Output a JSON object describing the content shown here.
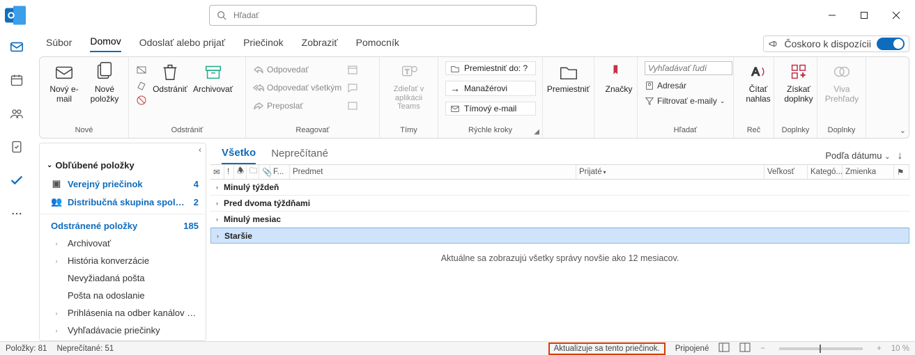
{
  "search_placeholder": "Hľadať",
  "tabs": {
    "file": "Súbor",
    "home": "Domov",
    "sendrec": "Odoslať alebo prijať",
    "folder": "Priečinok",
    "view": "Zobraziť",
    "help": "Pomocník"
  },
  "coming_soon": "Čoskoro k dispozícii",
  "ribbon": {
    "new": {
      "new_email": "Nový e-mail",
      "new_items": "Nové položky",
      "group": "Nové"
    },
    "delete": {
      "delete": "Odstrániť",
      "archive": "Archivovať",
      "group": "Odstrániť"
    },
    "respond": {
      "reply": "Odpovedať",
      "reply_all": "Odpovedať všetkým",
      "forward": "Preposlať",
      "group": "Reagovať"
    },
    "teams": {
      "share": "Zdieľať v aplikácii Teams",
      "group": "Tímy"
    },
    "quick": {
      "move_to": "Premiestniť do: ?",
      "manager": "Manažérovi",
      "team_mail": "Tímový e-mail",
      "group": "Rýchle kroky"
    },
    "move": {
      "move": "Premiestniť",
      "group": ""
    },
    "tags": {
      "tags": "Značky",
      "group": ""
    },
    "find": {
      "placeholder": "Vyhľadávať ľudí",
      "address": "Adresár",
      "filter": "Filtrovať e-maily",
      "group": "Hľadať"
    },
    "speech": {
      "read": "Čítať nahlas",
      "group": "Reč"
    },
    "addins": {
      "get": "Získať doplnky",
      "group": "Doplnky"
    },
    "viva": {
      "viva": "Viva Prehľady",
      "group": "Doplnky"
    }
  },
  "nav": {
    "fav_header": "Obľúbené položky",
    "items": [
      {
        "name": "Verejný priečinok",
        "count": "4",
        "bold": true,
        "icon": "folder"
      },
      {
        "name": "Distribučná skupina spolo...",
        "count": "2",
        "bold": true,
        "icon": "group"
      },
      {
        "name": "Odstránené položky",
        "count": "185",
        "bold": true,
        "icon": ""
      },
      {
        "name": "Archivovať",
        "expander": true
      },
      {
        "name": "História konverzácie",
        "expander": true
      },
      {
        "name": "Nevyžiadaná pošta"
      },
      {
        "name": "Pošta na odoslanie"
      },
      {
        "name": "Prihlásenia na odber kanálov RSS",
        "expander": true
      },
      {
        "name": "Vyhľadávacie priečinky",
        "expander": true
      }
    ]
  },
  "list": {
    "tab_all": "Všetko",
    "tab_unread": "Neprečítané",
    "sort": "Podľa dátumu",
    "cols": {
      "from": "F...",
      "subject": "Predmet",
      "received": "Prijaté",
      "size": "Veľkosť",
      "categ": "Kategó...",
      "mention": "Zmienka"
    },
    "groups": [
      "Minulý týždeň",
      "Pred dvoma týždňami",
      "Minulý mesiac",
      "Staršie"
    ],
    "info": "Aktuálne sa zobrazujú všetky správy novšie ako 12 mesiacov."
  },
  "status": {
    "items": "Položky: 81",
    "unread": "Neprečítané: 51",
    "updating": "Aktualizuje sa tento priečinok.",
    "connected": "Pripojené",
    "zoom": "10 %"
  }
}
